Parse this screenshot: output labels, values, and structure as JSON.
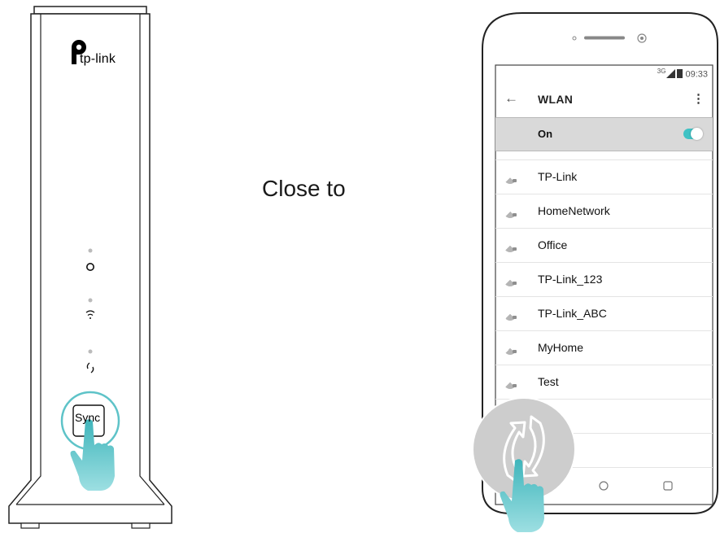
{
  "caption": "Close to",
  "router": {
    "brand": "tp-link",
    "sync_label": "Sync",
    "leds": [
      "power-led",
      "wifi-led",
      "sync-led"
    ]
  },
  "phone": {
    "status": {
      "network": "3G",
      "time": "09:33"
    },
    "title": "WLAN",
    "toggle_label": "On",
    "toggle_on": true,
    "networks": [
      "TP-Link",
      "HomeNetwork",
      "Office",
      "TP-Link_123",
      "TP-Link_ABC",
      "MyHome",
      "Test"
    ]
  },
  "colors": {
    "accent": "#3fc2c4",
    "hand": "#5ec3c8",
    "outline": "#222222",
    "list_separator": "#e4e4e4"
  }
}
